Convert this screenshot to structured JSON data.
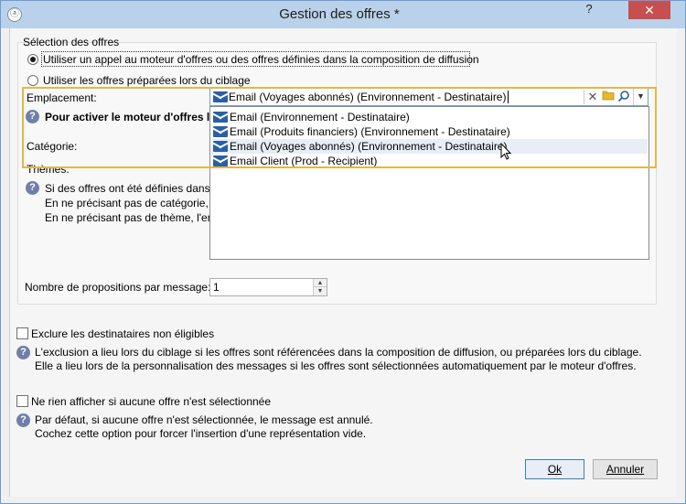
{
  "window": {
    "title": "Gestion des offres *",
    "help_glyph": "?",
    "close_glyph": "✕"
  },
  "selection": {
    "legend": "Sélection des offres",
    "radio_engine": "Utiliser un appel au moteur d'offres ou des offres définies dans la composition de diffusion",
    "radio_prepared": "Utiliser les offres préparées lors du ciblage"
  },
  "emplacement": {
    "label": "Emplacement:",
    "value": "Email (Voyages abonnés) (Environnement - Destinataire)",
    "options": [
      "Email (Environnement - Destinataire)",
      "Email (Produits financiers) (Environnement - Destinataire)",
      "Email (Voyages abonnés) (Environnement - Destinataire)",
      "Email Client (Prod - Recipient)"
    ],
    "hovered_index": 2
  },
  "engine_hint": "Pour activer le moteur d'offres le",
  "categorie_label": "Catégorie:",
  "themes_label": "Thèmes:",
  "offers_help": [
    "Si des offres ont été définies dans la",
    "En ne précisant pas de catégorie, l'e",
    "En ne précisant pas de thème, l'ens"
  ],
  "propositions": {
    "label": "Nombre de propositions par message:",
    "value": "1"
  },
  "exclude": {
    "label": "Exclure les destinataires non éligibles",
    "help_line1": "L'exclusion a lieu lors du ciblage si les offres sont référencées dans la composition de diffusion, ou préparées lors du ciblage.",
    "help_line2": "Elle a lieu lors de la personnalisation des messages si les offres sont sélectionnées automatiquement par le moteur d'offres."
  },
  "nothing": {
    "label": "Ne rien afficher si aucune offre n'est sélectionnée",
    "help_line1": "Par défaut, si aucune offre n'est sélectionnée, le message est annulé.",
    "help_line2": "Cochez cette option pour forcer l'insertion d'une représentation vide."
  },
  "buttons": {
    "ok": "Ok",
    "cancel": "Annuler"
  },
  "icons": {
    "clear": "clear-icon",
    "folder": "folder-icon",
    "search": "search-icon",
    "dropdown": "chevron-down-icon"
  },
  "colors": {
    "highlight": "#e0b84a",
    "close": "#c74f4f",
    "titlebar": "#b9d1ea"
  }
}
